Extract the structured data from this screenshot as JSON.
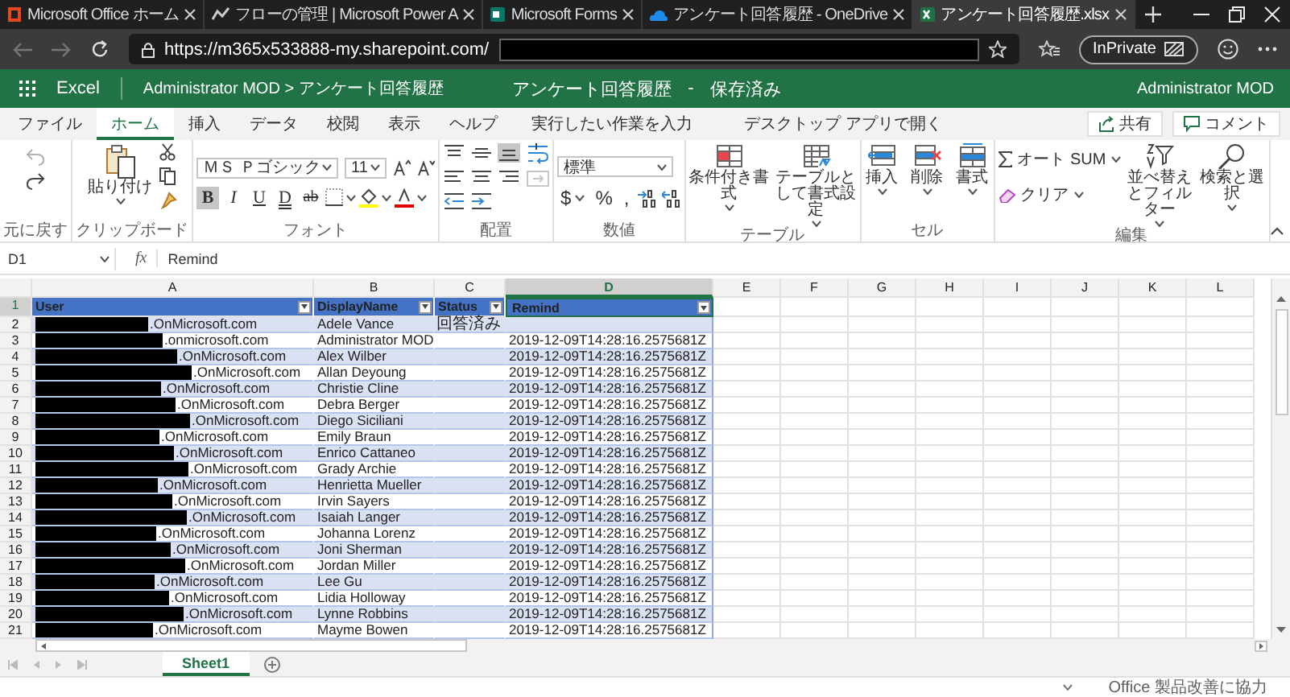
{
  "browser": {
    "tabs": [
      {
        "title": "Microsoft Office ホーム",
        "selected": false
      },
      {
        "title": "フローの管理 | Microsoft Power A",
        "selected": false
      },
      {
        "title": "Microsoft Forms",
        "selected": false
      },
      {
        "title": "アンケート回答履歴 - OneDrive",
        "selected": false
      },
      {
        "title": "アンケート回答履歴.xlsx",
        "selected": true
      }
    ],
    "url": "https://m365x533888-my.sharepoint.com/",
    "url_redacted": true,
    "inprivate": "InPrivate"
  },
  "app_bar": {
    "app": "Excel",
    "breadcrumb": "Administrator MOD > アンケート回答履歴",
    "file_name": "アンケート回答履歴",
    "separator": "-",
    "save_status": "保存済み",
    "user": "Administrator MOD"
  },
  "ribbon": {
    "tabs": [
      {
        "label": "ファイル",
        "selected": false
      },
      {
        "label": "ホーム",
        "selected": true
      },
      {
        "label": "挿入",
        "selected": false
      },
      {
        "label": "データ",
        "selected": false
      },
      {
        "label": "校閲",
        "selected": false
      },
      {
        "label": "表示",
        "selected": false
      },
      {
        "label": "ヘルプ",
        "selected": false
      }
    ],
    "search": {
      "placeholder": "実行したい作業を入力"
    },
    "open_desktop": "デスクトップ アプリで開く",
    "share": "共有",
    "comment": "コメント",
    "groups": [
      {
        "kind": "undo",
        "label": "元に戻す"
      },
      {
        "kind": "clipboard",
        "label": "クリップボード",
        "paste": "貼り付け"
      },
      {
        "kind": "font",
        "label": "フォント",
        "font_name": "ＭＳ Ｐゴシック",
        "font_size": "11",
        "buttons": [
          {
            "kind": "bold",
            "label": "B",
            "selected": true
          },
          {
            "kind": "italic",
            "label": "I",
            "selected": false
          },
          {
            "kind": "underline",
            "label": "U",
            "selected": false
          },
          {
            "kind": "double-underline",
            "label": "D",
            "selected": false
          },
          {
            "kind": "strikethrough",
            "label": "ab",
            "selected": false
          }
        ]
      },
      {
        "kind": "alignment",
        "label": "配置",
        "options": [
          {
            "kind": "top",
            "selected": false
          },
          {
            "kind": "middle",
            "selected": false
          },
          {
            "kind": "bottom",
            "selected": true
          },
          {
            "kind": "left",
            "selected": false
          },
          {
            "kind": "center",
            "selected": false
          },
          {
            "kind": "right",
            "selected": false
          },
          {
            "kind": "outdent",
            "selected": false
          },
          {
            "kind": "indent",
            "selected": false
          }
        ]
      },
      {
        "kind": "number",
        "label": "数値",
        "format": "標準",
        "symbols": [
          "$",
          "%",
          ","
        ]
      },
      {
        "kind": "table",
        "label": "テーブル",
        "items": [
          "条件付き書式",
          "テーブルとして書式設定"
        ]
      },
      {
        "kind": "cells",
        "label": "セル",
        "items": [
          "挿入",
          "削除",
          "書式"
        ]
      },
      {
        "kind": "editing",
        "label": "編集",
        "autosum": "オート SUM",
        "clear": "クリア",
        "items": [
          "並べ替えとフィルター",
          "検索と選択"
        ]
      }
    ]
  },
  "formula_bar": {
    "cell": "D1",
    "function_label": "fx",
    "content": "Remind"
  },
  "sheet": {
    "columns": [
      {
        "label": "A",
        "selected": false
      },
      {
        "label": "B",
        "selected": false
      },
      {
        "label": "C",
        "selected": false
      },
      {
        "label": "D",
        "selected": true
      },
      {
        "label": "E",
        "selected": false
      },
      {
        "label": "F",
        "selected": false
      },
      {
        "label": "G",
        "selected": false
      },
      {
        "label": "H",
        "selected": false
      },
      {
        "label": "I",
        "selected": false
      },
      {
        "label": "J",
        "selected": false
      },
      {
        "label": "K",
        "selected": false
      },
      {
        "label": "L",
        "selected": false
      }
    ],
    "header_row": {
      "number": "1",
      "selected": true,
      "cells": [
        "User",
        "DisplayName",
        "Status",
        "Remind"
      ]
    },
    "rows": [
      {
        "number": "2",
        "user": ".OnMicrosoft.com",
        "redacted": true,
        "name": "Adele Vance",
        "status": "回答済み"
      },
      {
        "number": "3",
        "user": ".onmicrosoft.com",
        "redacted": true,
        "name": "Administrator MOD",
        "remind": "2019-12-09T14:28:16.2575681Z"
      },
      {
        "number": "4",
        "user": ".OnMicrosoft.com",
        "redacted": true,
        "name": "Alex Wilber",
        "remind": "2019-12-09T14:28:16.2575681Z"
      },
      {
        "number": "5",
        "user": ".OnMicrosoft.com",
        "redacted": true,
        "name": "Allan Deyoung",
        "remind": "2019-12-09T14:28:16.2575681Z"
      },
      {
        "number": "6",
        "user": ".OnMicrosoft.com",
        "redacted": true,
        "name": "Christie Cline",
        "remind": "2019-12-09T14:28:16.2575681Z"
      },
      {
        "number": "7",
        "user": ".OnMicrosoft.com",
        "redacted": true,
        "name": "Debra Berger",
        "remind": "2019-12-09T14:28:16.2575681Z"
      },
      {
        "number": "8",
        "user": ".OnMicrosoft.com",
        "redacted": true,
        "name": "Diego Siciliani",
        "remind": "2019-12-09T14:28:16.2575681Z"
      },
      {
        "number": "9",
        "user": ".OnMicrosoft.com",
        "redacted": true,
        "name": "Emily Braun",
        "remind": "2019-12-09T14:28:16.2575681Z"
      },
      {
        "number": "10",
        "user": ".OnMicrosoft.com",
        "redacted": true,
        "name": "Enrico Cattaneo",
        "remind": "2019-12-09T14:28:16.2575681Z"
      },
      {
        "number": "11",
        "user": ".OnMicrosoft.com",
        "redacted": true,
        "name": "Grady Archie",
        "remind": "2019-12-09T14:28:16.2575681Z"
      },
      {
        "number": "12",
        "user": ".OnMicrosoft.com",
        "redacted": true,
        "name": "Henrietta Mueller",
        "remind": "2019-12-09T14:28:16.2575681Z"
      },
      {
        "number": "13",
        "user": ".OnMicrosoft.com",
        "redacted": true,
        "name": "Irvin Sayers",
        "remind": "2019-12-09T14:28:16.2575681Z"
      },
      {
        "number": "14",
        "user": ".OnMicrosoft.com",
        "redacted": true,
        "name": "Isaiah Langer",
        "remind": "2019-12-09T14:28:16.2575681Z"
      },
      {
        "number": "15",
        "user": ".OnMicrosoft.com",
        "redacted": true,
        "name": "Johanna Lorenz",
        "remind": "2019-12-09T14:28:16.2575681Z"
      },
      {
        "number": "16",
        "user": ".OnMicrosoft.com",
        "redacted": true,
        "name": "Joni Sherman",
        "remind": "2019-12-09T14:28:16.2575681Z"
      },
      {
        "number": "17",
        "user": ".OnMicrosoft.com",
        "redacted": true,
        "name": "Jordan Miller",
        "remind": "2019-12-09T14:28:16.2575681Z"
      },
      {
        "number": "18",
        "user": ".OnMicrosoft.com",
        "redacted": true,
        "name": "Lee Gu",
        "remind": "2019-12-09T14:28:16.2575681Z"
      },
      {
        "number": "19",
        "user": ".OnMicrosoft.com",
        "redacted": true,
        "name": "Lidia Holloway",
        "remind": "2019-12-09T14:28:16.2575681Z"
      },
      {
        "number": "20",
        "user": ".OnMicrosoft.com",
        "redacted": true,
        "name": "Lynne Robbins",
        "remind": "2019-12-09T14:28:16.2575681Z"
      },
      {
        "number": "21",
        "user": ".OnMicrosoft.com",
        "redacted": true,
        "name": "Mayme Bowen",
        "remind": "2019-12-09T14:28:16.2575681Z"
      }
    ]
  },
  "sheet_tabs": [
    {
      "label": "Sheet1",
      "selected": true
    }
  ],
  "status_bar": {
    "feedback": "Office 製品改善に協力"
  }
}
